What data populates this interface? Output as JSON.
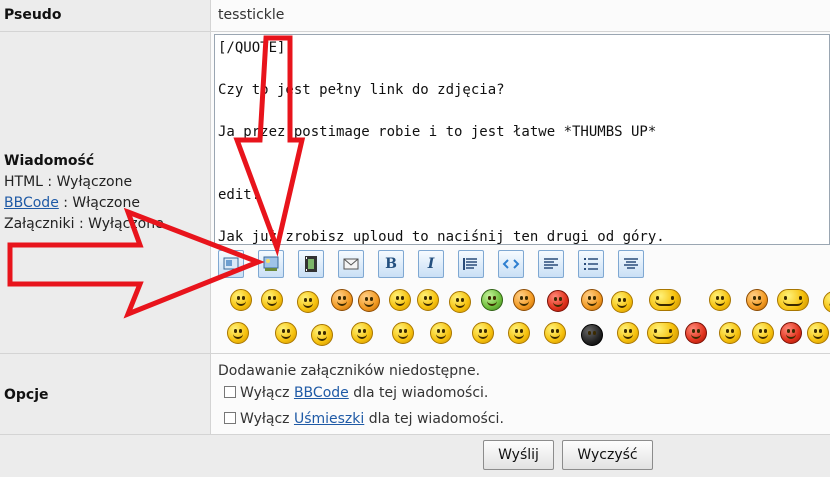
{
  "pseudo": {
    "label": "Pseudo",
    "value": "tesstickle"
  },
  "message": {
    "label": "Wiadomość",
    "html_status": "HTML : Wyłączone",
    "bbcode_link": "BBCode",
    "bbcode_status": " : Włączone",
    "attachments_status": "Załączniki : Wyłączone",
    "text": "[/QUOTE]\n\nCzy to jest pełny link do zdjęcia?\n\nJa przez postimage robie i to jest łatwe *THUMBS UP*\n\n\nedit:\n\nJak już zrobisz uploud to naciśnij ten drugi od góry.\nTo skopiujesz link do zdjęcia."
  },
  "toolbar": {
    "buttons": [
      {
        "name": "image-link-icon"
      },
      {
        "name": "image-icon"
      },
      {
        "name": "film-icon"
      },
      {
        "name": "email-icon"
      },
      {
        "name": "bold-icon",
        "glyph": "B"
      },
      {
        "name": "italic-icon",
        "glyph": "I"
      },
      {
        "name": "quote-icon"
      },
      {
        "name": "code-icon"
      },
      {
        "name": "align-left-icon"
      },
      {
        "name": "list-icon"
      },
      {
        "name": "align-center-icon"
      }
    ]
  },
  "options": {
    "label": "Opcje",
    "attachments_note": "Dodawanie załączników niedostępne.",
    "disable_prefix": "Wyłącz",
    "bbcode_link": "BBCode",
    "smilies_link": "Uśmieszki",
    "suffix": "dla tej wiadomości."
  },
  "buttons": {
    "send": "Wyślij",
    "clear": "Wyczyść"
  },
  "colors": {
    "annotation": "#e8141c",
    "label_bg": "#ececec",
    "link": "#1f5aa6"
  }
}
